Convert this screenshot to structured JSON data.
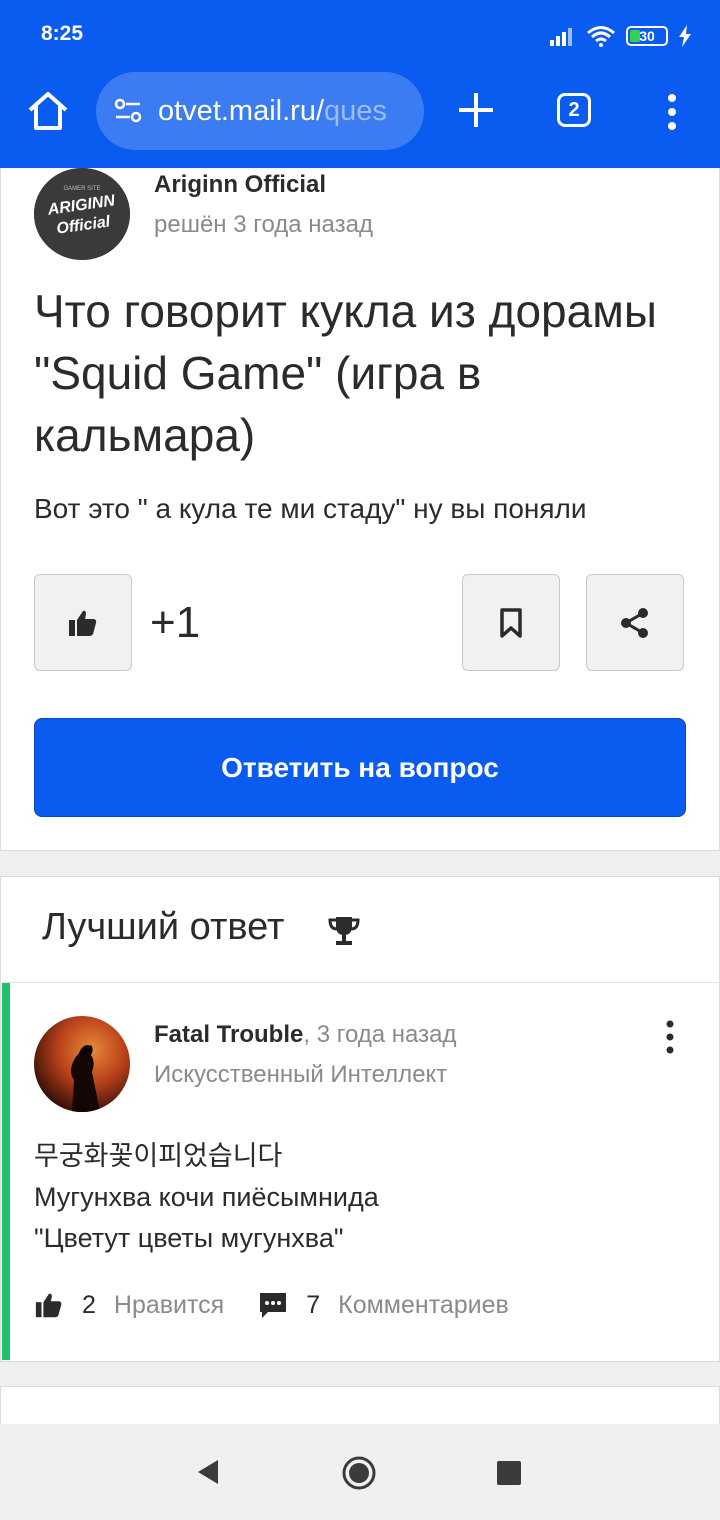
{
  "status_bar": {
    "time": "8:25",
    "battery": "30",
    "icons": [
      "signal-icon",
      "wifi-icon",
      "battery-icon",
      "charging-icon"
    ]
  },
  "browser": {
    "url_main": "otvet.mail.ru/",
    "url_fade": "ques",
    "tab_count": "2",
    "icons": [
      "home-icon",
      "site-settings-icon",
      "plus-icon",
      "tabs-icon",
      "menu-icon"
    ]
  },
  "question": {
    "author_name": "Ariginn Official",
    "avatar_text_top": "ARIGINN",
    "avatar_text_bottom": "Official",
    "avatar_small": "GAMER SITE",
    "status": "решён 3 года назад",
    "title": "Что говорит кукла из дорамы \"Squid Game\" (игра в кальмара)",
    "body": "Вот это \" а кула те ми стаду\" ну вы поняли",
    "likes": "+1",
    "answer_button": "Ответить на вопрос"
  },
  "best_answer": {
    "heading": "Лучший ответ",
    "author_name": "Fatal Trouble",
    "time": ", 3 года назад",
    "role": "Искусственный Интеллект",
    "lines": [
      "무궁화꽃이피었습니다",
      "Мугунхва кочи пиёсымнида",
      "\"Цветут цветы мугунхва\""
    ],
    "like_count": "2",
    "like_label": "Нравится",
    "comment_count": "7",
    "comment_label": "Комментариев"
  },
  "colors": {
    "brand_blue": "#0a5cf0",
    "best_green": "#1ec26b"
  }
}
